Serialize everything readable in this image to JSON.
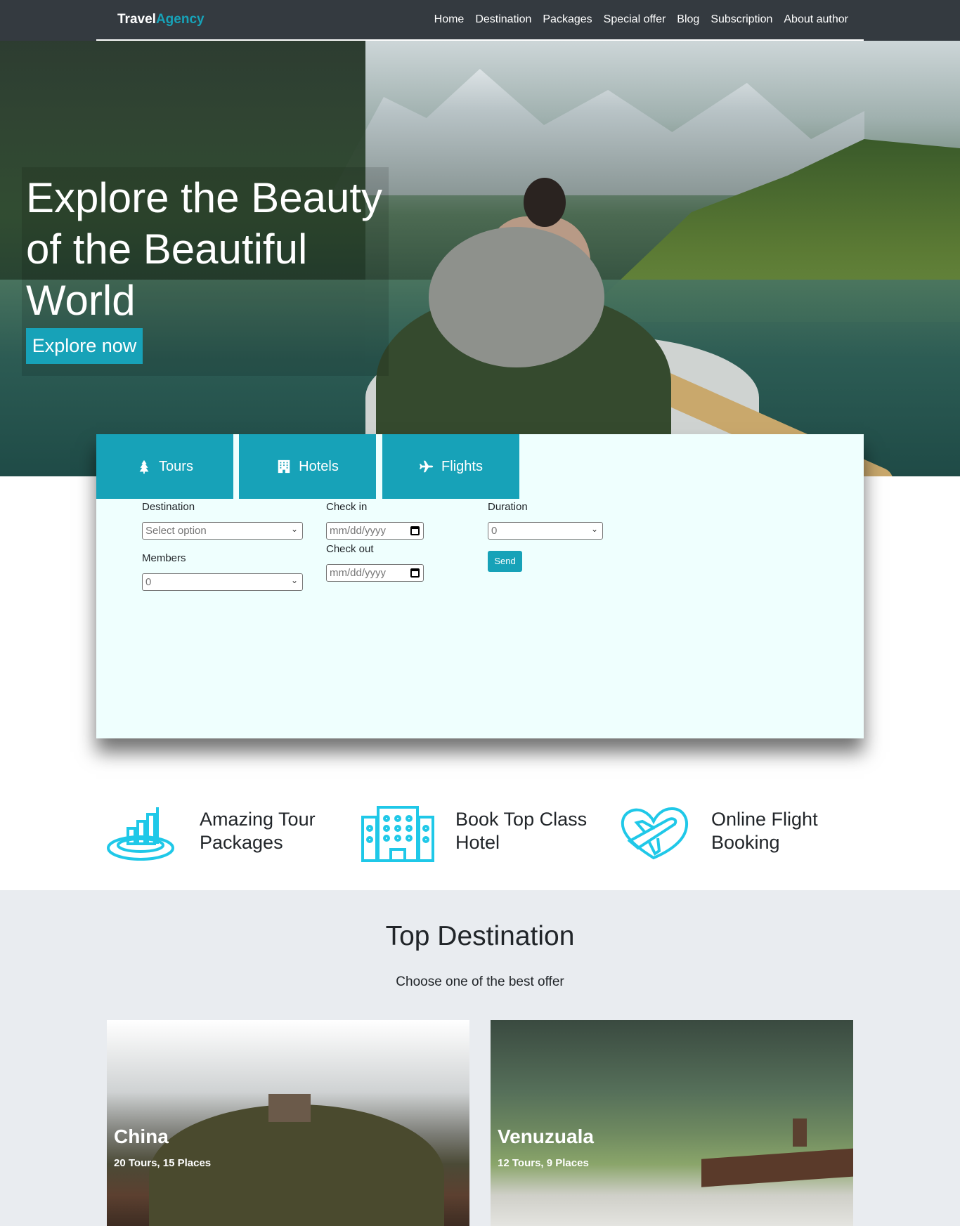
{
  "navbar": {
    "brand_main": "Travel",
    "brand_accent": "Agency",
    "links": [
      "Home",
      "Destination",
      "Packages",
      "Special offer",
      "Blog",
      "Subscription",
      "About author"
    ]
  },
  "hero": {
    "title": "Explore the Beauty of the Beautiful World",
    "button": "Explore now"
  },
  "booking": {
    "tabs": [
      {
        "label": "Tours",
        "icon": "tree-icon"
      },
      {
        "label": "Hotels",
        "icon": "hotel-icon"
      },
      {
        "label": "Flights",
        "icon": "plane-icon"
      }
    ],
    "destination_label": "Destination",
    "destination_value": "Select option",
    "members_label": "Members",
    "members_value": "0",
    "checkin_label": "Check in",
    "checkin_placeholder": "mm/dd/yyyy",
    "checkout_label": "Check out",
    "checkout_placeholder": "mm/dd/yyyy",
    "duration_label": "Duration",
    "duration_value": "0",
    "send_label": "Send"
  },
  "features": [
    {
      "text": "Amazing Tour Packages",
      "icon": "tour-package-icon"
    },
    {
      "text": "Book Top Class Hotel",
      "icon": "hotel-building-icon"
    },
    {
      "text": "Online Flight Booking",
      "icon": "flight-heart-icon"
    }
  ],
  "destinations": {
    "title": "Top Destination",
    "subtitle": "Choose one of the best offer",
    "cards": [
      {
        "name": "China",
        "meta": "20 Tours, 15 Places"
      },
      {
        "name": "Venuzuala",
        "meta": "12 Tours, 9 Places"
      }
    ]
  },
  "colors": {
    "accent": "#17a2b8",
    "navbar_bg": "#343a40",
    "panel_bg": "#effffe",
    "feature_icon": "#1fc8e8",
    "section_bg": "#e9ecf0"
  }
}
